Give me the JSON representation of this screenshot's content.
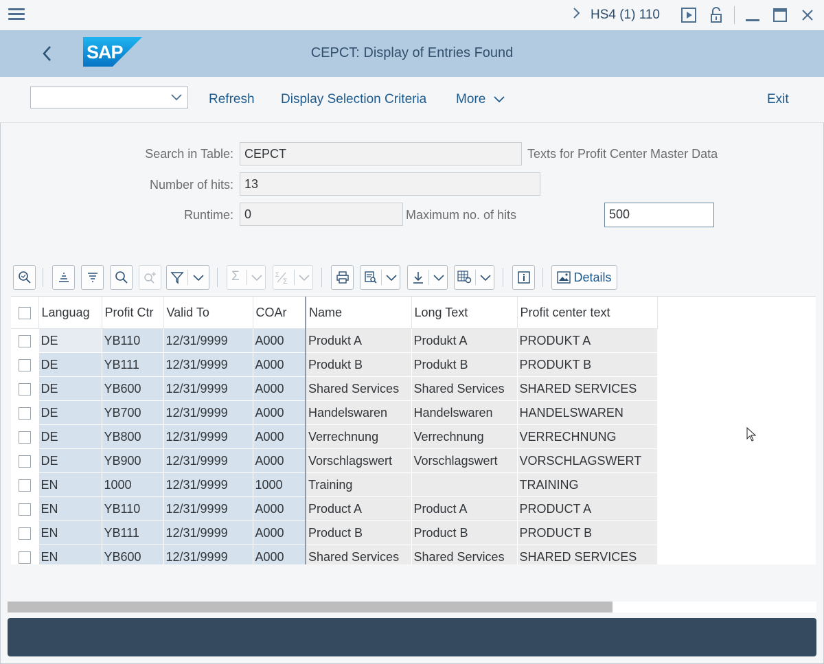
{
  "window": {
    "system": "HS4 (1) 110"
  },
  "header": {
    "logo_text": "SAP",
    "title": "CEPCT: Display of Entries Found"
  },
  "toolbar": {
    "refresh_label": "Refresh",
    "display_selection_label": "Display Selection Criteria",
    "more_label": "More",
    "exit_label": "Exit"
  },
  "form": {
    "search_table_label": "Search in Table:",
    "search_table_value": "CEPCT",
    "search_table_desc": "Texts for Profit Center Master Data",
    "hits_label": "Number of hits:",
    "hits_value": "13",
    "runtime_label": "Runtime:",
    "runtime_value": "0",
    "max_hits_label": "Maximum no. of hits",
    "max_hits_value": "500"
  },
  "alv_toolbar": {
    "details_label": "Details"
  },
  "grid": {
    "columns": [
      "Languag",
      "Profit Ctr",
      "Valid To",
      "COAr",
      "Name",
      "Long Text",
      "Profit center text"
    ],
    "rows": [
      [
        "DE",
        "YB110",
        "12/31/9999",
        "A000",
        "Produkt A",
        "Produkt A",
        "PRODUKT A"
      ],
      [
        "DE",
        "YB111",
        "12/31/9999",
        "A000",
        "Produkt B",
        "Produkt B",
        "PRODUKT B"
      ],
      [
        "DE",
        "YB600",
        "12/31/9999",
        "A000",
        "Shared Services",
        "Shared Services",
        "SHARED SERVICES"
      ],
      [
        "DE",
        "YB700",
        "12/31/9999",
        "A000",
        "Handelswaren",
        "Handelswaren",
        "HANDELSWAREN"
      ],
      [
        "DE",
        "YB800",
        "12/31/9999",
        "A000",
        "Verrechnung",
        "Verrechnung",
        "VERRECHNUNG"
      ],
      [
        "DE",
        "YB900",
        "12/31/9999",
        "A000",
        "Vorschlagswert",
        "Vorschlagswert",
        "VORSCHLAGSWERT"
      ],
      [
        "EN",
        "1000",
        "12/31/9999",
        "1000",
        "Training",
        "",
        "TRAINING"
      ],
      [
        "EN",
        "YB110",
        "12/31/9999",
        "A000",
        "Product A",
        "Product A",
        "PRODUCT A"
      ],
      [
        "EN",
        "YB111",
        "12/31/9999",
        "A000",
        "Product B",
        "Product B",
        "PRODUCT B"
      ],
      [
        "EN",
        "YB600",
        "12/31/9999",
        "A000",
        "Shared Services",
        "Shared Services",
        "SHARED SERVICES"
      ]
    ]
  },
  "colors": {
    "shell": "#b3cbe0",
    "key_cell": "#d5e1ec",
    "text_cell": "#ebebeb",
    "status_bar": "#354a5f"
  }
}
